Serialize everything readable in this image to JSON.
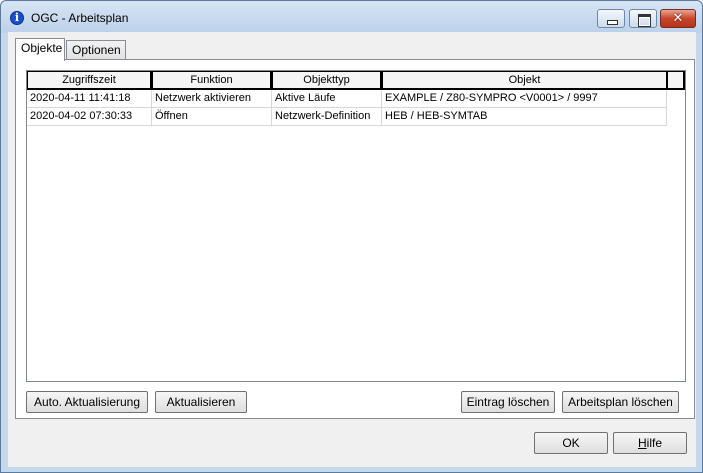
{
  "window": {
    "title": "OGC - Arbeitsplan"
  },
  "tabs": [
    {
      "label": "Objekte",
      "active": true
    },
    {
      "label": "Optionen",
      "active": false
    }
  ],
  "table": {
    "columns": [
      "Zugriffszeit",
      "Funktion",
      "Objekttyp",
      "Objekt"
    ],
    "rows": [
      [
        "2020-04-11  11:41:18",
        "Netzwerk aktivieren",
        "Aktive Läufe",
        "EXAMPLE / Z80-SYMPRO <V0001> / 9997"
      ],
      [
        "2020-04-02  07:30:33",
        "Öffnen",
        "Netzwerk-Definition",
        "HEB / HEB-SYMTAB"
      ]
    ]
  },
  "panel_buttons": {
    "auto_refresh": "Auto. Aktualisierung",
    "refresh": "Aktualisieren",
    "delete_entry": "Eintrag löschen",
    "delete_plan": "Arbeitsplan löschen"
  },
  "dialog_buttons": {
    "ok": "OK",
    "help_first": "H",
    "help_rest": "ilfe"
  },
  "icons": {
    "app": "info-icon",
    "minimize": "minimize-icon",
    "maximize": "maximize-icon",
    "close": "close-icon"
  }
}
